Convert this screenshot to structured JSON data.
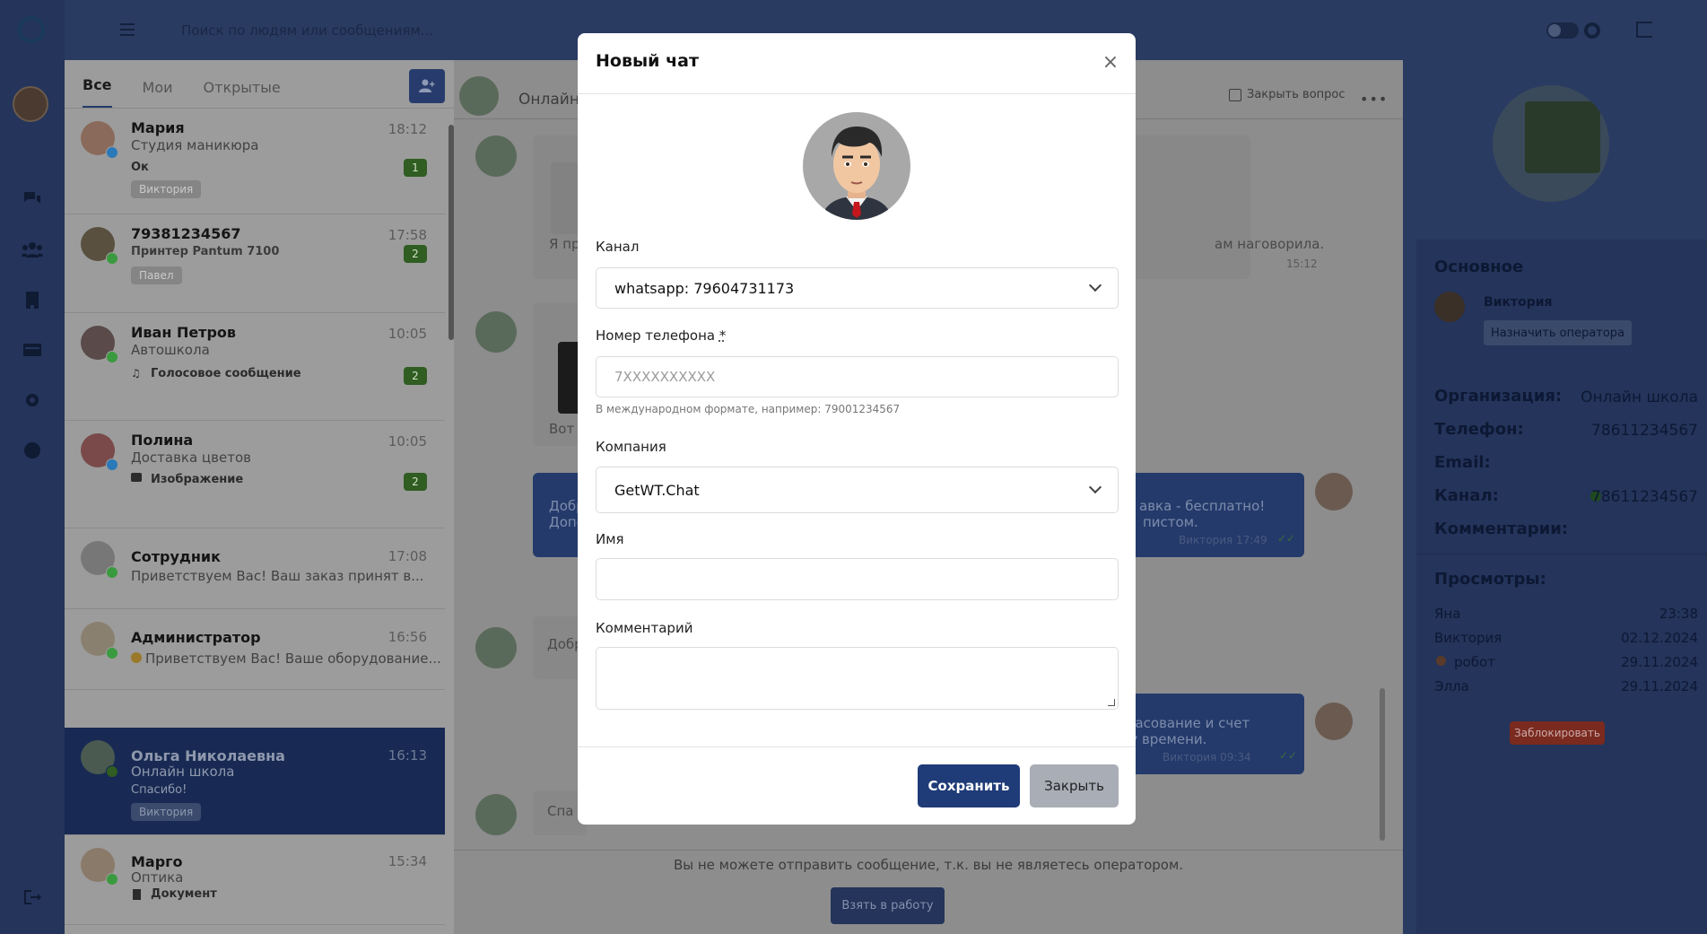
{
  "topbar": {
    "search_placeholder": "Поиск по людям или сообщениям..."
  },
  "sidebar": {
    "icons": [
      "chat-icon",
      "users-icon",
      "building-icon",
      "card-icon",
      "gear-icon",
      "help-icon",
      "logout-icon"
    ]
  },
  "chat_list": {
    "tabs": [
      "Все",
      "Мои",
      "Открытые"
    ],
    "items": [
      {
        "name": "Мария",
        "time": "18:12",
        "sub": "Студия маникюра",
        "msg": "Ок",
        "count": "1",
        "tag": "Виктория",
        "channel": "telegram"
      },
      {
        "name": "79381234567",
        "time": "17:58",
        "sub": "",
        "msg": "Принтер Pantum 7100",
        "count": "2",
        "tag": "Павел",
        "channel": "whatsapp"
      },
      {
        "name": "Иван Петров",
        "time": "10:05",
        "sub": "Автошкола",
        "msg": "Голосовое сообщение",
        "count": "2",
        "tag": "",
        "channel": "whatsapp"
      },
      {
        "name": "Полина",
        "time": "10:05",
        "sub": "Доставка цветов",
        "msg": "Изображение",
        "count": "2",
        "tag": "",
        "channel": "telegram"
      },
      {
        "name": "Сотрудник",
        "time": "17:08",
        "sub": "Приветствуем Вас! Ваш заказ принят в...",
        "msg": "",
        "count": "",
        "tag": "",
        "channel": "whatsapp"
      },
      {
        "name": "Администратор",
        "time": "16:56",
        "sub": "Приветствуем Вас! Ваше оборудование...",
        "msg": "",
        "count": "",
        "tag": "",
        "channel": "whatsapp"
      },
      {
        "name": "Ольга Николаевна",
        "time": "16:13",
        "sub": "Онлайн школа",
        "msg": "Спасибо!",
        "count": "",
        "tag": "Виктория",
        "channel": "whatsapp"
      },
      {
        "name": "Марго",
        "time": "15:34",
        "sub": "Оптика",
        "msg": "Документ",
        "count": "",
        "tag": "",
        "channel": "whatsapp"
      }
    ]
  },
  "center": {
    "header_name": "Онлайн",
    "close_question": "Закрыть вопрос",
    "bubbles": [
      {
        "text": "Я пр",
        "tail": "ам наговорила.",
        "time": "15:12"
      },
      {
        "text": "Вот"
      },
      {
        "text": "Добр",
        "text2": "Допо",
        "tail": "авка - бесплатно!",
        "tail2": "пистом.",
        "meta": "Виктория  17:49"
      },
      {
        "text": "Добр"
      },
      {
        "tail": "гласование и счет",
        "tail2": "му времени.",
        "meta": "Виктория  09:34"
      },
      {
        "text": "Спа"
      }
    ],
    "footnote": "Вы не можете отправить сообщение, т.к. вы не являетесь оператором.",
    "take_button": "Взять в работу"
  },
  "right_panel": {
    "section_main": "Основное",
    "operator_name": "Виктория",
    "assign_button": "Назначить оператора",
    "fields": [
      {
        "label": "Организация:",
        "value": "Онлайн школа"
      },
      {
        "label": "Телефон:",
        "value": "78611234567"
      },
      {
        "label": "Email:",
        "value": ""
      },
      {
        "label": "Канал:",
        "value": "78611234567"
      },
      {
        "label": "Комментарии:",
        "value": ""
      }
    ],
    "views_title": "Просмотры:",
    "views": [
      {
        "name": "Яна",
        "date": "23:38"
      },
      {
        "name": "Виктория",
        "date": "02.12.2024"
      },
      {
        "name": "робот",
        "date": "29.11.2024"
      },
      {
        "name": "Элла",
        "date": "29.11.2024"
      }
    ],
    "block_button": "Заблокировать"
  },
  "modal": {
    "title": "Новый чат",
    "channel_label": "Канал",
    "channel_value": "whatsapp: 79604731173",
    "phone_label": "Номер телефона",
    "phone_required": "*",
    "phone_placeholder": "7XXXXXXXXXX",
    "phone_hint": "В международном формате, например: 79001234567",
    "company_label": "Компания",
    "company_value": "GetWT.Chat",
    "name_label": "Имя",
    "name_value": "",
    "comment_label": "Комментарий",
    "comment_value": "",
    "save_button": "Сохранить",
    "close_button": "Закрыть"
  },
  "colors": {
    "accent": "#1f3b78",
    "whatsapp": "#3a9a3f",
    "telegram": "#2a79b8",
    "block": "#7a2a1f"
  }
}
